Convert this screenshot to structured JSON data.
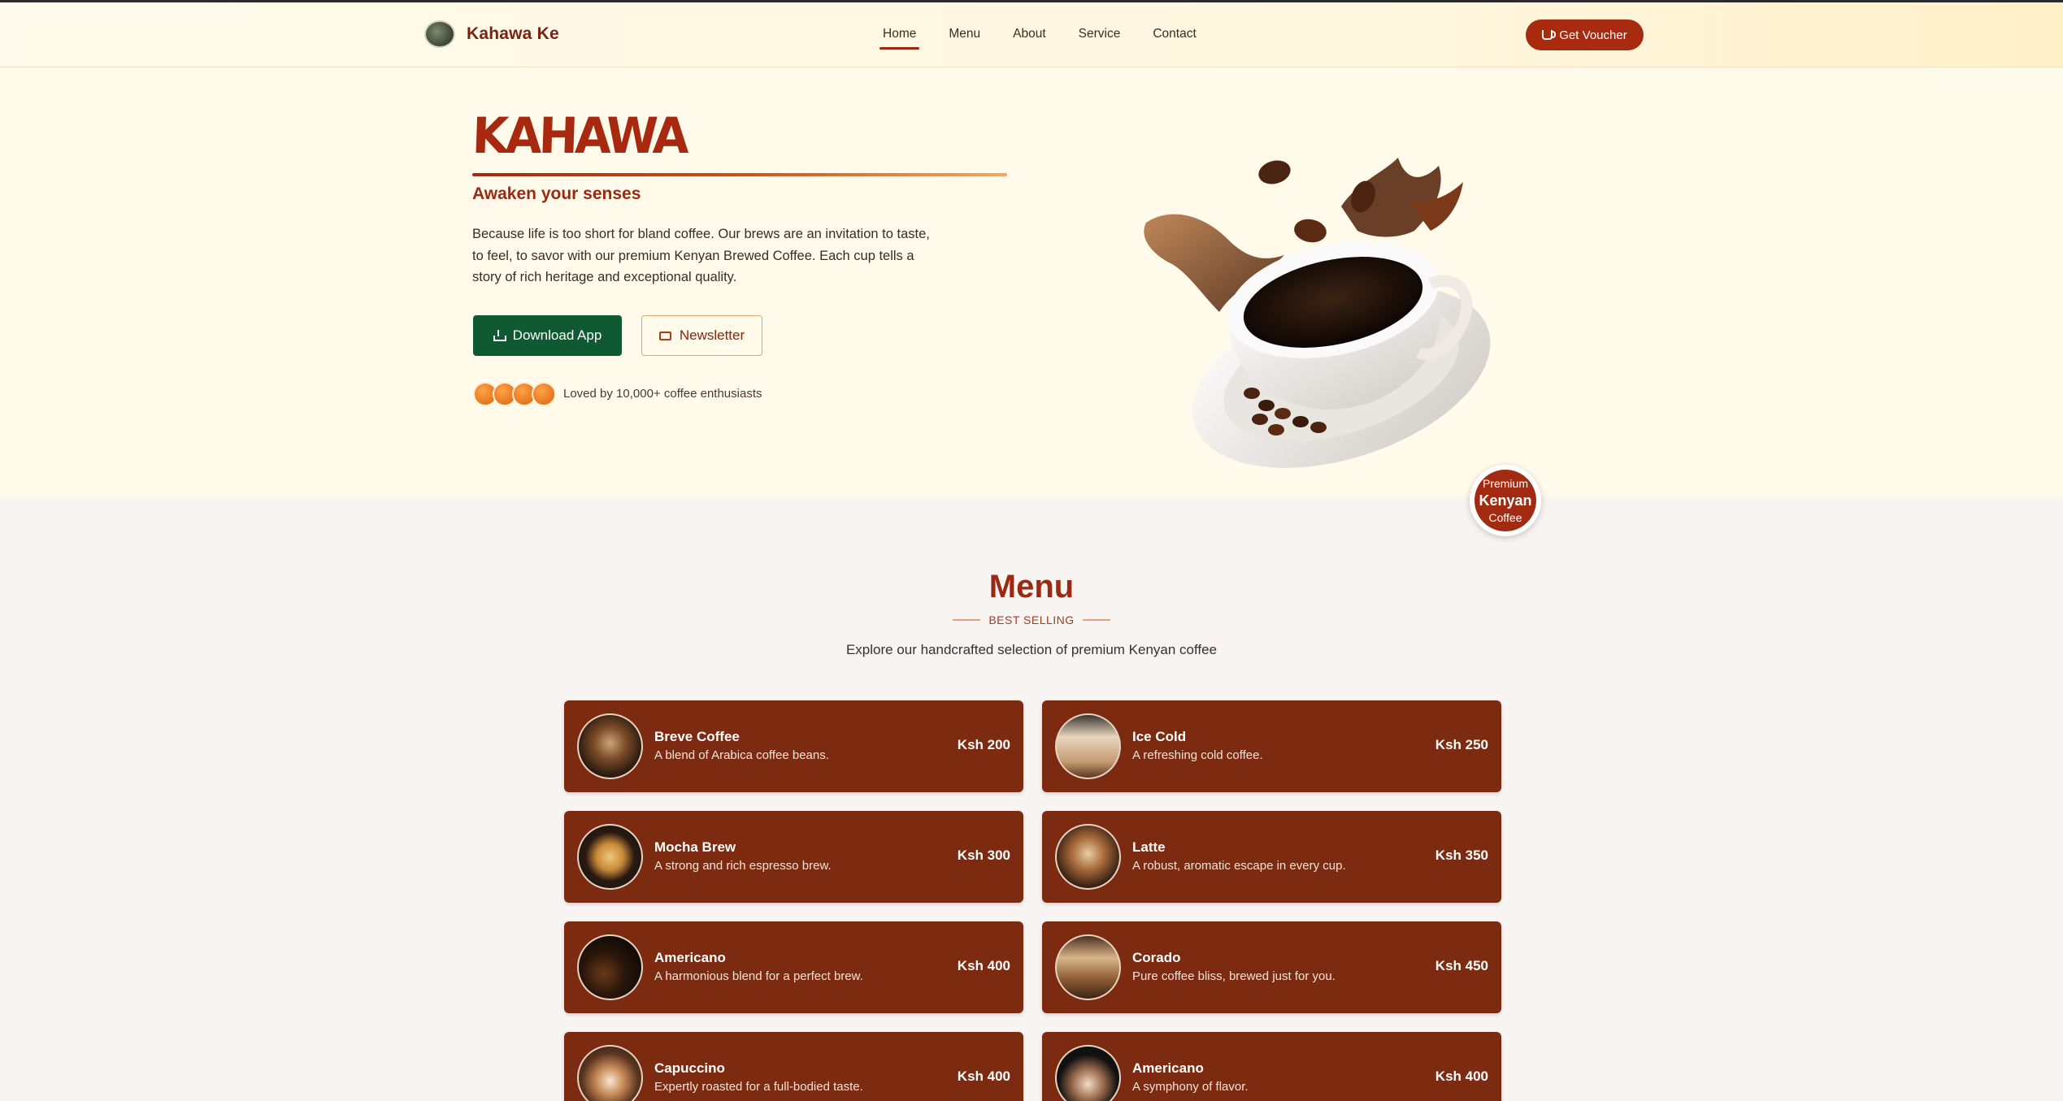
{
  "header": {
    "brand": "Kahawa Ke",
    "nav": [
      "Home",
      "Menu",
      "About",
      "Service",
      "Contact"
    ],
    "voucher_label": "Get Voucher"
  },
  "hero": {
    "logo_text": "KAHAWA",
    "tagline": "Awaken your senses",
    "description": "Because life is too short for bland coffee. Our brews are an invitation to taste, to feel, to savor with our premium Kenyan Brewed Coffee. Each cup tells a story of rich heritage and exceptional quality.",
    "download_label": "Download App",
    "newsletter_label": "Newsletter",
    "loved_text": "Loved by 10,000+ coffee enthusiasts",
    "badge": {
      "line1": "Premium",
      "line2": "Kenyan",
      "line3": "Coffee"
    }
  },
  "menu": {
    "title": "Menu",
    "subtitle": "BEST SELLING",
    "intro": "Explore our handcrafted selection of premium Kenyan coffee",
    "items": [
      {
        "name": "Breve Coffee",
        "desc": "A blend of Arabica coffee beans.",
        "price": "Ksh 200"
      },
      {
        "name": "Ice Cold",
        "desc": "A refreshing cold coffee.",
        "price": "Ksh 250"
      },
      {
        "name": "Mocha Brew",
        "desc": "A strong and rich espresso brew.",
        "price": "Ksh 300"
      },
      {
        "name": "Latte",
        "desc": "A robust, aromatic escape in every cup.",
        "price": "Ksh 350"
      },
      {
        "name": "Americano",
        "desc": "A harmonious blend for a perfect brew.",
        "price": "Ksh 400"
      },
      {
        "name": "Corado",
        "desc": "Pure coffee bliss, brewed just for you.",
        "price": "Ksh 450"
      },
      {
        "name": "Capuccino",
        "desc": "Expertly roasted for a full-bodied taste.",
        "price": "Ksh 400"
      },
      {
        "name": "Americano",
        "desc": "A symphony of flavor.",
        "price": "Ksh 400"
      }
    ]
  },
  "colors": {
    "brand": "#9a2a12",
    "card": "#7c2a10",
    "download": "#0f5a32",
    "hero_bg": "#fffaea"
  }
}
